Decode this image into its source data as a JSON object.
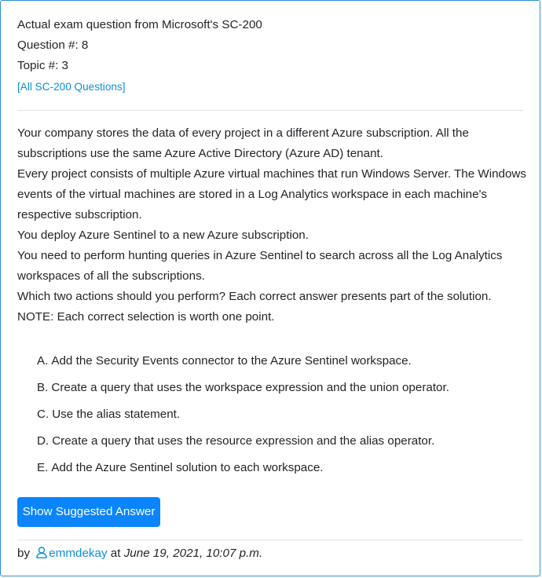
{
  "header": {
    "exam_title": "Actual exam question from Microsoft's SC-200",
    "question_number": "Question #: 8",
    "topic": "Topic #: 3",
    "all_questions_link": "[All SC-200 Questions]"
  },
  "question": {
    "paragraphs": [
      "Your company stores the data of every project in a different Azure subscription. All the subscriptions use the same Azure Active Directory (Azure AD) tenant.",
      "Every project consists of multiple Azure virtual machines that run Windows Server. The Windows events of the virtual machines are stored in a Log Analytics workspace in each machine's respective subscription.",
      "You deploy Azure Sentinel to a new Azure subscription.",
      "You need to perform hunting queries in Azure Sentinel to search across all the Log Analytics workspaces of all the subscriptions.",
      "Which two actions should you perform? Each correct answer presents part of the solution.",
      "NOTE: Each correct selection is worth one point."
    ]
  },
  "choices": [
    {
      "letter": "A.",
      "text": "Add the Security Events connector to the Azure Sentinel workspace."
    },
    {
      "letter": "B.",
      "text": "Create a query that uses the workspace expression and the union operator."
    },
    {
      "letter": "C.",
      "text": "Use the alias statement."
    },
    {
      "letter": "D.",
      "text": "Create a query that uses the resource expression and the alias operator."
    },
    {
      "letter": "E.",
      "text": "Add the Azure Sentinel solution to each workspace."
    }
  ],
  "show_answer_button": "Show Suggested Answer",
  "footer": {
    "by": "by",
    "icon": "user-icon",
    "username": "emmdekay",
    "at": "at",
    "date": "June 19, 2021, 10:07 p.m."
  },
  "colors": {
    "link": "#0d8fd6",
    "button": "#0a84ff",
    "border": "#2b8fd6"
  }
}
